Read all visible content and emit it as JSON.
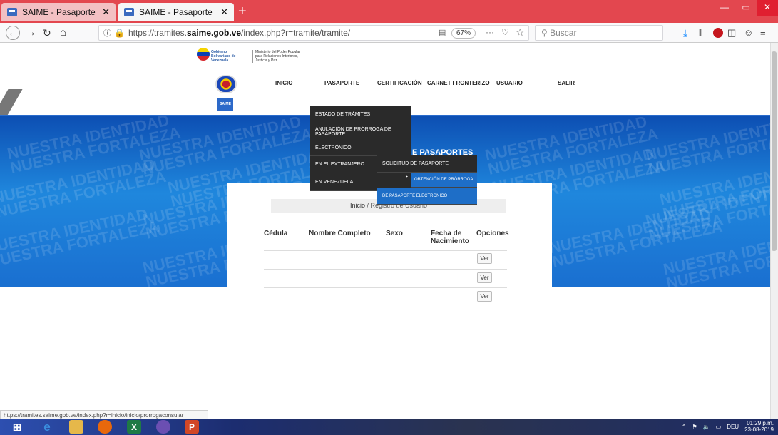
{
  "browser": {
    "tabs": [
      {
        "title": "SAIME - Pasaporte",
        "active": false
      },
      {
        "title": "SAIME - Pasaporte",
        "active": true
      }
    ],
    "new_tab": "+",
    "url_prefix": "https://tramites.",
    "url_domain": "saime.gob.ve",
    "url_path": "/index.php?r=tramite/tramite/",
    "zoom": "67%",
    "search_placeholder": "Buscar",
    "accent_color": "#e3474f",
    "status_url": "https://tramites.saime.gob.ve/index.php?r=inicio/inicio/prorrogaconsular"
  },
  "site": {
    "gov_title": "Gobierno Bolivariano de Venezuela",
    "ministry": "Ministerio del Poder Popular para Relaciones Interiores, Justicia y Paz",
    "logo_text": "SAIME",
    "nav": [
      "INICIO",
      "PASAPORTE",
      "CERTIFICACIÓN",
      "CARNET FRONTERIZO",
      "USUARIO",
      "SALIR"
    ],
    "banner_watermark": [
      "NUESTRA IDENTIDAD",
      "NUESTRA FORTALEZA"
    ],
    "hero_title_fragment": "E PASAPORTES",
    "hero_color": "#1a6fd0"
  },
  "menus": {
    "pasaporte": [
      "ESTADO DE TRÁMITES",
      "ANULACIÓN DE PRÓRROGA DE PASAPORTE",
      "ELECTRÓNICO",
      "EN EL EXTRANJERO",
      "EN VENEZUELA"
    ],
    "extranjero": [
      "SOLICITUD DE PASAPORTE"
    ],
    "solicitud": [
      "OBTENCIÓN DE PRÓRROGA",
      "DE PASAPORTE ELECTRÓNICO"
    ]
  },
  "breadcrumb": {
    "home": "Inicio",
    "sep": "/",
    "current": "Registro de Usuario"
  },
  "table": {
    "headers": [
      "Cédula",
      "Nombre Completo",
      "Sexo",
      "Fecha de Nacimiento",
      "Opciones"
    ],
    "rows": [
      {
        "button": "Ver"
      },
      {
        "button": "Ver"
      },
      {
        "button": "Ver"
      }
    ]
  },
  "taskbar": {
    "lang": "DEU",
    "time": "01:29 p.m.",
    "date": "23-08-2019"
  }
}
